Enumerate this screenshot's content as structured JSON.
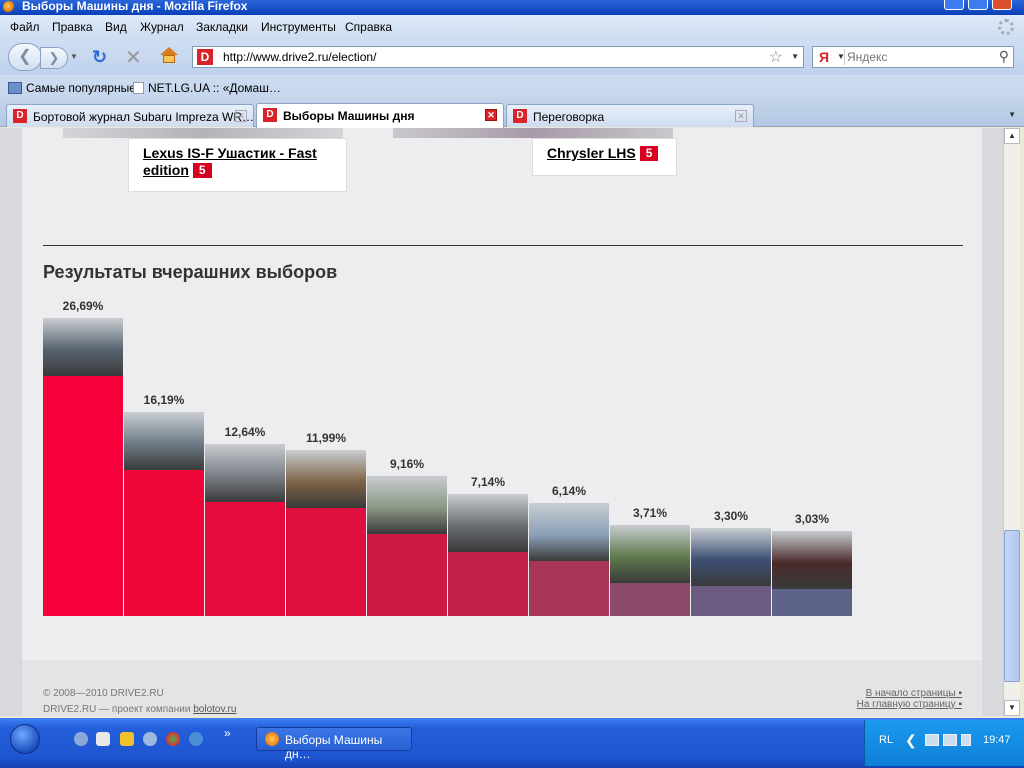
{
  "window": {
    "title": "Выборы Машины дня - Mozilla Firefox"
  },
  "menu": [
    "Файл",
    "Правка",
    "Вид",
    "Журнал",
    "Закладки",
    "Инструменты",
    "Справка"
  ],
  "nav": {
    "url": "http://www.drive2.ru/election/",
    "search_placeholder": "Яндекс",
    "search_engine": "Я",
    "site_favicon": "D"
  },
  "bookmarks": [
    "Самые популярные",
    "NET.LG.UA :: «Домаш…"
  ],
  "tabs": [
    {
      "label": "Бортовой журнал Subaru Impreza WR…",
      "active": false
    },
    {
      "label": "Выборы Машины дня",
      "active": true
    },
    {
      "label": "Переговорка",
      "active": false
    }
  ],
  "candidates": [
    {
      "name": "Lexus IS-F Ушастик - Fast edition",
      "votes": "5"
    },
    {
      "name": "Chrysler LHS",
      "votes": "5"
    }
  ],
  "results_title": "Результаты вчерашних выборов",
  "chart_data": {
    "type": "bar",
    "values": [
      26.69,
      16.19,
      12.64,
      11.99,
      9.16,
      7.14,
      6.14,
      3.71,
      3.3,
      3.03
    ],
    "labels": [
      "26,69%",
      "16,19%",
      "12,64%",
      "11,99%",
      "9,16%",
      "7,14%",
      "6,14%",
      "3,71%",
      "3,30%",
      "3,03%"
    ],
    "colors": [
      "#f5003a",
      "#ee0638",
      "#e60c3c",
      "#dc0f3e",
      "#cc1a44",
      "#c22049",
      "#a93658",
      "#8c4a6a",
      "#6c5b80",
      "#5e6489"
    ]
  },
  "footer": {
    "copyright": "© 2008—2010 DRIVE2.RU",
    "project_prefix": "DRIVE2.RU — проект компании",
    "company": "bolotov.ru",
    "to_top": "В начало страницы",
    "to_home": "На главную страницу"
  },
  "taskbar": {
    "active_window": "Выборы Машины дн…",
    "language": "RL",
    "clock": "19:47"
  }
}
